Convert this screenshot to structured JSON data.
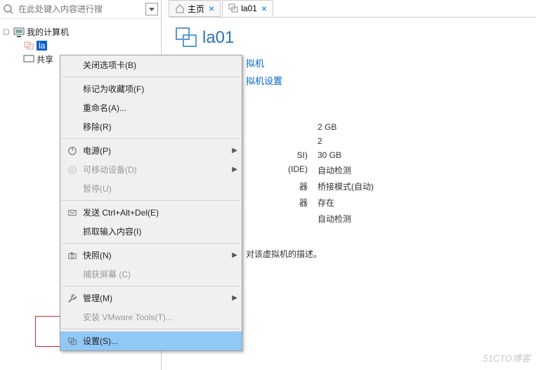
{
  "search": {
    "placeholder": "在此处键入内容进行搜"
  },
  "tree": {
    "root": "我的计算机",
    "selected": "la",
    "share": "共享"
  },
  "tabs": {
    "home": "主页",
    "active": "la01"
  },
  "vm": {
    "title": "la01",
    "links": {
      "power": "拟机",
      "settings": "拟机设置"
    },
    "props": [
      {
        "k": "",
        "v": "2 GB"
      },
      {
        "k": "",
        "v": "2"
      },
      {
        "k": "SI)",
        "v": "30 GB"
      },
      {
        "k": "(IDE)",
        "v": "自动检测"
      },
      {
        "k": "器",
        "v": "桥接模式(自动)"
      },
      {
        "k": "器",
        "v": "存在"
      },
      {
        "k": "",
        "v": "自动检测"
      }
    ],
    "desc": "对该虚拟机的描述。"
  },
  "menu": [
    {
      "t": "关闭选项卡(B)",
      "icon": ""
    },
    {
      "sep": true
    },
    {
      "t": "标记为收藏项(F)",
      "icon": ""
    },
    {
      "t": "重命名(A)...",
      "icon": ""
    },
    {
      "t": "移除(R)",
      "icon": ""
    },
    {
      "sep": true
    },
    {
      "t": "电源(P)",
      "icon": "power",
      "sub": true
    },
    {
      "t": "可移动设备(D)",
      "icon": "disc",
      "sub": true,
      "disabled": true
    },
    {
      "t": "暂停(U)",
      "icon": "",
      "disabled": true
    },
    {
      "sep": true
    },
    {
      "t": "发送 Ctrl+Alt+Del(E)",
      "icon": "send"
    },
    {
      "t": "抓取输入内容(I)",
      "icon": ""
    },
    {
      "sep": true
    },
    {
      "t": "快照(N)",
      "icon": "camera",
      "sub": true
    },
    {
      "t": "捕获屏幕 (C)",
      "icon": "",
      "disabled": true
    },
    {
      "sep": true
    },
    {
      "t": "管理(M)",
      "icon": "wrench",
      "sub": true
    },
    {
      "t": "安装 VMware Tools(T)...",
      "icon": "",
      "disabled": true
    },
    {
      "sep": true
    },
    {
      "t": "设置(S)...",
      "icon": "settings",
      "highlight": true
    }
  ],
  "watermark": "51CTO博客"
}
